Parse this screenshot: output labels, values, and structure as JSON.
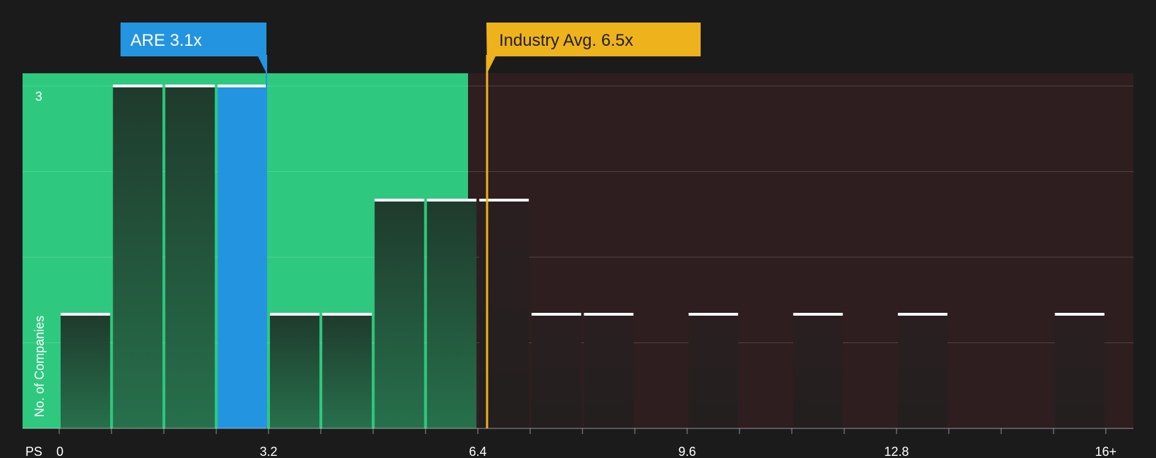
{
  "chart_data": {
    "type": "bar",
    "title": "",
    "xlabel": "PS",
    "ylabel": "No. of Companies",
    "x_ticks": [
      "0",
      "3.2",
      "6.4",
      "9.6",
      "12.8",
      "16+"
    ],
    "y_ticks": [
      "3"
    ],
    "ylim": [
      0,
      3
    ],
    "xlim": [
      0,
      16
    ],
    "bin_width": 0.8,
    "bars": [
      {
        "x": 0.0,
        "value": 1
      },
      {
        "x": 0.8,
        "value": 3
      },
      {
        "x": 1.6,
        "value": 3
      },
      {
        "x": 2.4,
        "value": 3,
        "highlight": true
      },
      {
        "x": 3.2,
        "value": 1
      },
      {
        "x": 4.0,
        "value": 1
      },
      {
        "x": 4.8,
        "value": 2
      },
      {
        "x": 5.6,
        "value": 2
      },
      {
        "x": 6.4,
        "value": 2
      },
      {
        "x": 7.2,
        "value": 1
      },
      {
        "x": 8.0,
        "value": 1
      },
      {
        "x": 9.6,
        "value": 1
      },
      {
        "x": 11.2,
        "value": 1
      },
      {
        "x": 12.8,
        "value": 1
      },
      {
        "x": 15.2,
        "value": 1
      }
    ],
    "good_zone_max": 6.2,
    "company": {
      "label": "ARE 3.1x",
      "value": 3.1
    },
    "industry": {
      "label": "Industry Avg. 6.5x",
      "value": 6.5
    },
    "grid": true
  },
  "colors": {
    "background": "#1b1b1c",
    "good_zone": "#2ec97f",
    "bad_zone": "#2f1e1f",
    "bar_dark": "#1e2b24",
    "bar_highlight": "#2394e0",
    "bar_cap": "#ffffff",
    "company": "#2394e0",
    "industry": "#eeb21d",
    "text": "#ffffff",
    "industry_text": "#1f1f1f"
  }
}
